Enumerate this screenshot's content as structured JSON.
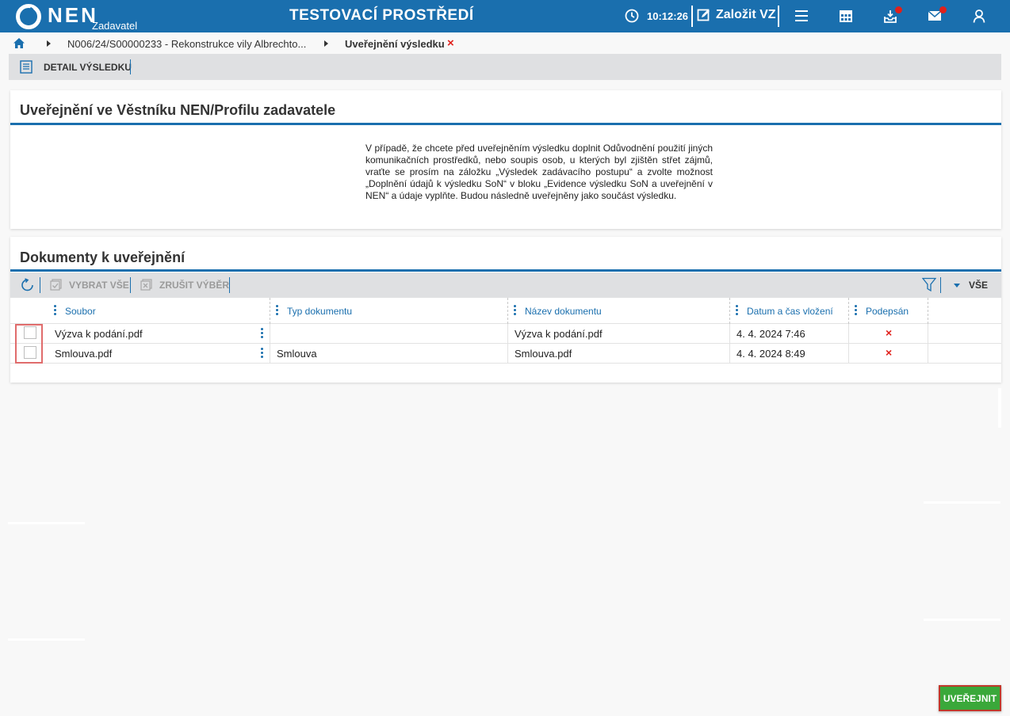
{
  "header": {
    "logo_text": "NEN",
    "logo_sub": "Zadavatel",
    "environment_title": "TESTOVACÍ PROSTŘEDÍ",
    "clock_time": "10:12:26",
    "create_vz_label": "Založit VZ",
    "icons": [
      "clock-icon",
      "edit-icon",
      "menu-icon",
      "calendar-icon",
      "inbox-icon",
      "mail-icon",
      "user-icon"
    ],
    "notification_color": "#e0201b",
    "brand_color": "#1a6fae"
  },
  "breadcrumb": {
    "items": [
      "N006/24/S00000233 - Rekonstrukce vily Albrechto..."
    ],
    "current": "Uveřejnění výsledku",
    "close_symbol": "×"
  },
  "tabs": {
    "detail_label": "DETAIL VÝSLEDKU"
  },
  "publication_panel": {
    "title": "Uveřejnění ve Věstníku NEN/Profilu zadavatele",
    "info_text": "V případě, že chcete před uveřejněním výsledku doplnit Odůvodnění použití jiných komunikačních prostředků, nebo soupis osob, u kterých byl zjištěn střet zájmů, vraťte se prosím na záložku „Výsledek zadávacího postupu“ a zvolte možnost „Doplnění údajů k výsledku SoN“ v bloku „Evidence výsledku SoN a uveřejnění v NEN“ a údaje vyplňte. Budou následně uveřejněny jako součást výsledku."
  },
  "documents_panel": {
    "title": "Dokumenty k uveřejnění",
    "toolbar": {
      "select_all_label": "VYBRAT VŠE",
      "deselect_label": "ZRUŠIT VÝBĚR",
      "filter_all_label": "VŠE"
    },
    "columns": [
      "Soubor",
      "Typ dokumentu",
      "Název dokumentu",
      "Datum a čas vložení",
      "Podepsán"
    ],
    "rows": [
      {
        "soubor": "Výzva k podání.pdf",
        "typ": "",
        "nazev": "Výzva k podání.pdf",
        "datum": "4. 4. 2024 7:46",
        "podepsan": "×"
      },
      {
        "soubor": "Smlouva.pdf",
        "typ": "Smlouva",
        "nazev": "Smlouva.pdf",
        "datum": "4. 4. 2024 8:49",
        "podepsan": "×"
      }
    ]
  },
  "actions": {
    "publish_label": "UVEŘEJNIT",
    "publish_color": "#3aa83a"
  }
}
